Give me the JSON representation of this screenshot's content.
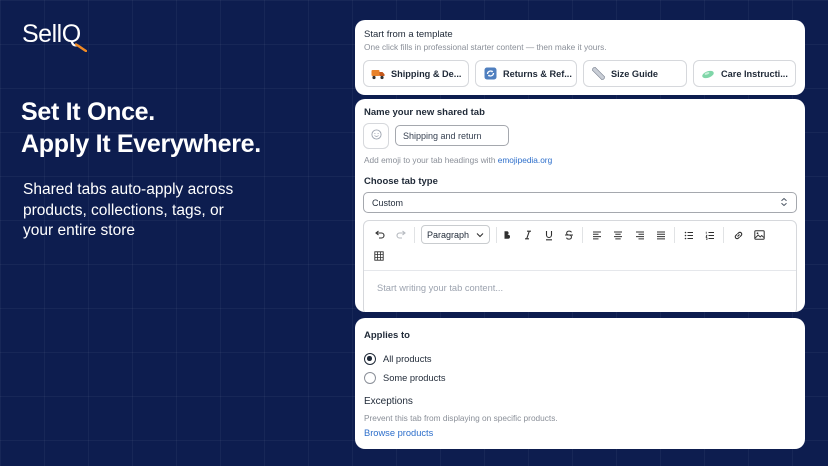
{
  "brand": {
    "logo_text": "SellQ"
  },
  "hero": {
    "headline_line1": "Set It Once.",
    "headline_line2": "Apply It Everywhere.",
    "subcopy_line1": "Shared tabs auto-apply across",
    "subcopy_line2": "products, collections, tags, or",
    "subcopy_line3": "your entire store"
  },
  "templates": {
    "title": "Start from a template",
    "subtitle": "One click fills in professional starter content — then make it yours.",
    "items": [
      {
        "label": "Shipping & De...",
        "icon": "truck-icon"
      },
      {
        "label": "Returns & Ref...",
        "icon": "return-arrows-icon"
      },
      {
        "label": "Size Guide",
        "icon": "ruler-icon"
      },
      {
        "label": "Care Instructi...",
        "icon": "soap-icon"
      }
    ]
  },
  "tab_form": {
    "name_label": "Name your new shared tab",
    "name_value": "Shipping and return",
    "helper_text": "Add emoji to your tab headings with",
    "helper_link": "emojipedia.org",
    "type_label": "Choose tab type",
    "type_value": "Custom",
    "paragraph_value": "Paragraph",
    "editor_placeholder": "Start writing your tab content..."
  },
  "applies": {
    "title": "Applies to",
    "options": [
      {
        "label": "All products",
        "selected": true
      },
      {
        "label": "Some products",
        "selected": false
      }
    ],
    "exceptions_title": "Exceptions",
    "exceptions_sub": "Prevent this tab from displaying on specific products.",
    "browse_label": "Browse products"
  },
  "colors": {
    "background": "#0d1d4f",
    "link": "#2c6ecb",
    "accent_orange": "#f08a24"
  }
}
